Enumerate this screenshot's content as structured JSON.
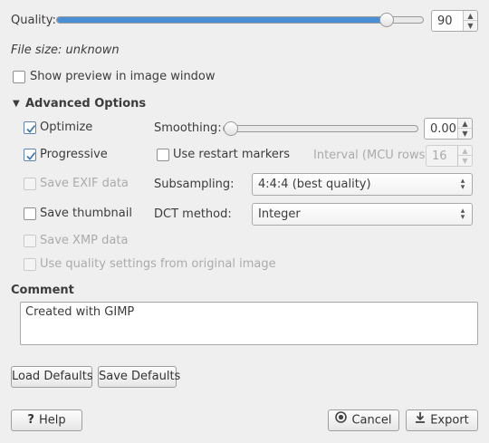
{
  "quality": {
    "label": "Quality:",
    "value": "90",
    "slider_fraction": 0.9
  },
  "file_size": "File size: unknown",
  "show_preview": {
    "label": "Show preview in image window",
    "checked": false
  },
  "advanced": {
    "header": "Advanced Options",
    "optimize": {
      "label": "Optimize",
      "checked": true
    },
    "progressive": {
      "label": "Progressive",
      "checked": true
    },
    "save_exif": {
      "label": "Save EXIF data",
      "checked": false,
      "enabled": false
    },
    "save_thumbnail": {
      "label": "Save thumbnail",
      "checked": false
    },
    "save_xmp": {
      "label": "Save XMP data",
      "checked": false,
      "enabled": false
    },
    "use_quality": {
      "label": "Use quality settings from original image",
      "checked": false,
      "enabled": false
    },
    "smoothing": {
      "label": "Smoothing:",
      "value": "0.00",
      "slider_fraction": 0.0
    },
    "restart_markers": {
      "label": "Use restart markers",
      "checked": false
    },
    "interval": {
      "label": "Interval (MCU rows):",
      "value": "16"
    },
    "subsampling": {
      "label": "Subsampling:",
      "value": "4:4:4 (best quality)"
    },
    "dct": {
      "label": "DCT method:",
      "value": "Integer"
    }
  },
  "comment": {
    "label": "Comment",
    "value": "Created with GIMP"
  },
  "buttons": {
    "load_defaults": "Load Defaults",
    "save_defaults": "Save Defaults",
    "help": "Help",
    "cancel": "Cancel",
    "export": "Export"
  },
  "colors": {
    "accent": "#4a8fd6",
    "check": "#3e7ab8",
    "background": "#efefef"
  }
}
